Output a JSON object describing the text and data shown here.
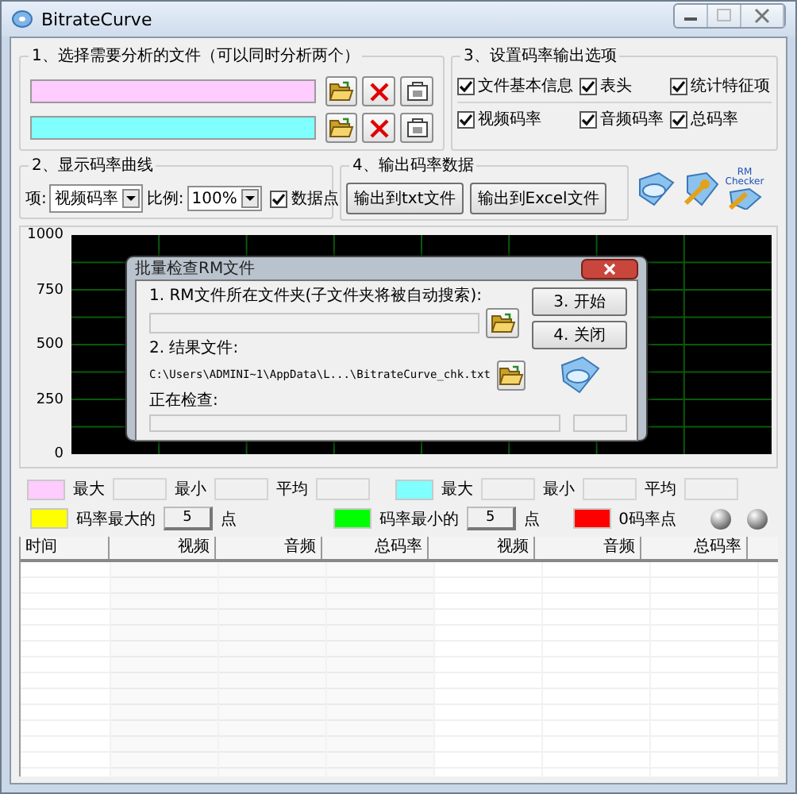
{
  "window": {
    "title": "BitrateCurve"
  },
  "file_group": {
    "title": "1、选择需要分析的文件（可以同时分析两个）",
    "files": [
      {
        "color": "#ffccff"
      },
      {
        "color": "#80ffff"
      }
    ]
  },
  "output_options": {
    "title": "3、设置码率输出选项",
    "options": [
      {
        "label": "文件基本信息",
        "checked": true
      },
      {
        "label": "表头",
        "checked": true
      },
      {
        "label": "统计特征项",
        "checked": true
      },
      {
        "label": "视频码率",
        "checked": true
      },
      {
        "label": "音频码率",
        "checked": true
      },
      {
        "label": "总码率",
        "checked": true
      }
    ]
  },
  "curve_group": {
    "title": "2、显示码率曲线",
    "item_label": "项:",
    "item_value": "视频码率",
    "scale_label": "比例:",
    "scale_value": "100%",
    "data_points": {
      "label": "数据点",
      "checked": true
    }
  },
  "export_group": {
    "title": "4、输出码率数据",
    "buttons": [
      "输出到txt文件",
      "输出到Excel文件"
    ]
  },
  "tools": [
    {
      "kind": "disc"
    },
    {
      "kind": "wrench"
    },
    {
      "kind": "checker",
      "label": "RM Checker"
    }
  ],
  "chart": {
    "axis_labels": [
      "1000",
      "750",
      "500",
      "250",
      "0"
    ]
  },
  "stats": [
    {
      "color": "#ffccff",
      "labels": [
        "最大",
        "最小",
        "平均"
      ]
    },
    {
      "color": "#80ffff",
      "labels": [
        "最大",
        "最小",
        "平均"
      ]
    }
  ],
  "markers": [
    {
      "kind": "count",
      "color": "#ffff00",
      "label": "码率最大的",
      "count": "5",
      "unit": "点"
    },
    {
      "kind": "count",
      "color": "#00ff00",
      "label": "码率最小的",
      "count": "5",
      "unit": "点"
    },
    {
      "kind": "plain",
      "color": "#ff0000",
      "label": "0码率点"
    }
  ],
  "table": {
    "columns": [
      "时间",
      "视频",
      "音频",
      "总码率",
      "视频",
      "音频",
      "总码率"
    ]
  },
  "dialog": {
    "title": "批量检查RM文件",
    "folder_label": "1. RM文件所在文件夹(子文件夹将被自动搜索):",
    "result_label": "2. 结果文件:",
    "result_value": "C:\\Users\\ADMINI~1\\AppData\\L...\\BitrateCurve_chk.txt",
    "checking_label": "正在检查:",
    "buttons": [
      "3. 开始",
      "4. 关闭"
    ]
  }
}
